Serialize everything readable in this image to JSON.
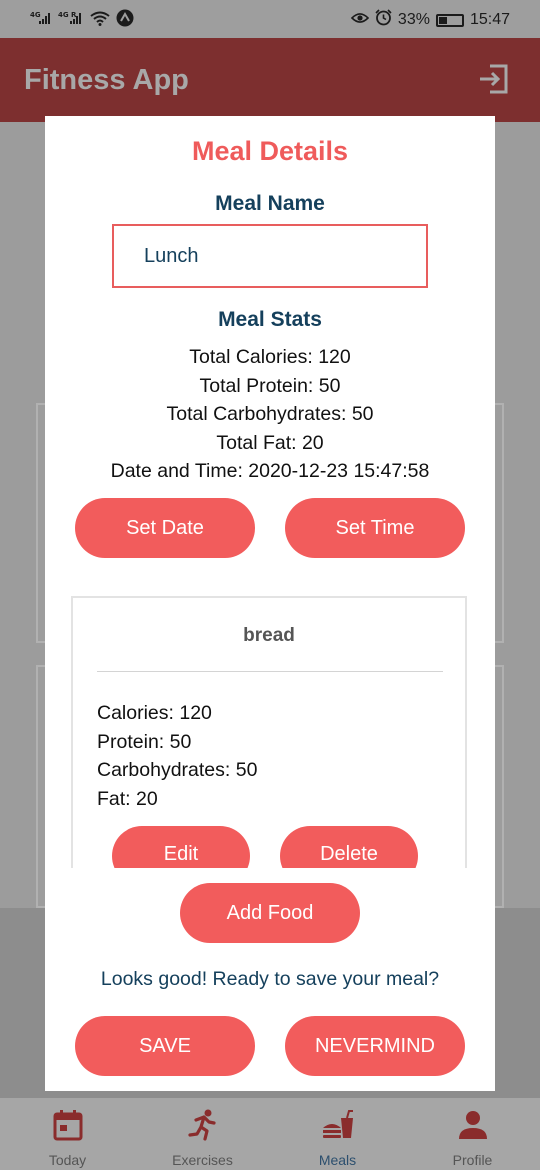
{
  "status_bar": {
    "signal_1": "4G",
    "signal_2": "4G R",
    "battery": "33%",
    "time": "15:47"
  },
  "app_bar": {
    "title": "Fitness App",
    "logout_icon": "logout-icon"
  },
  "dialog": {
    "title": "Meal Details",
    "meal_name_label": "Meal Name",
    "meal_name_value": "Lunch",
    "meal_stats_label": "Meal Stats",
    "stats": {
      "calories": "Total Calories: 120",
      "protein": "Total Protein: 50",
      "carbs": "Total Carbohydrates: 50",
      "fat": "Total Fat: 20",
      "datetime": "Date and Time: 2020-12-23 15:47:58"
    },
    "set_date_label": "Set Date",
    "set_time_label": "Set Time",
    "food_item": {
      "name": "bread",
      "calories": "Calories: 120",
      "protein": "Protein: 50",
      "carbs": "Carbohydrates: 50",
      "fat": "Fat: 20",
      "edit_label": "Edit",
      "delete_label": "Delete"
    },
    "add_food_label": "Add Food",
    "save_prompt": "Looks good! Ready to save your meal?",
    "save_label": "SAVE",
    "nevermind_label": "NEVERMIND"
  },
  "bottom_nav": {
    "items": [
      {
        "label": "Today",
        "icon": "calendar-icon"
      },
      {
        "label": "Exercises",
        "icon": "running-icon"
      },
      {
        "label": "Meals",
        "icon": "fastfood-icon",
        "active": true
      },
      {
        "label": "Profile",
        "icon": "person-icon"
      }
    ]
  },
  "colors": {
    "accent": "#f25c5c",
    "title": "#ef5b5b",
    "heading": "#15405c",
    "app_bar_dimmed": "#7d2f2f"
  }
}
